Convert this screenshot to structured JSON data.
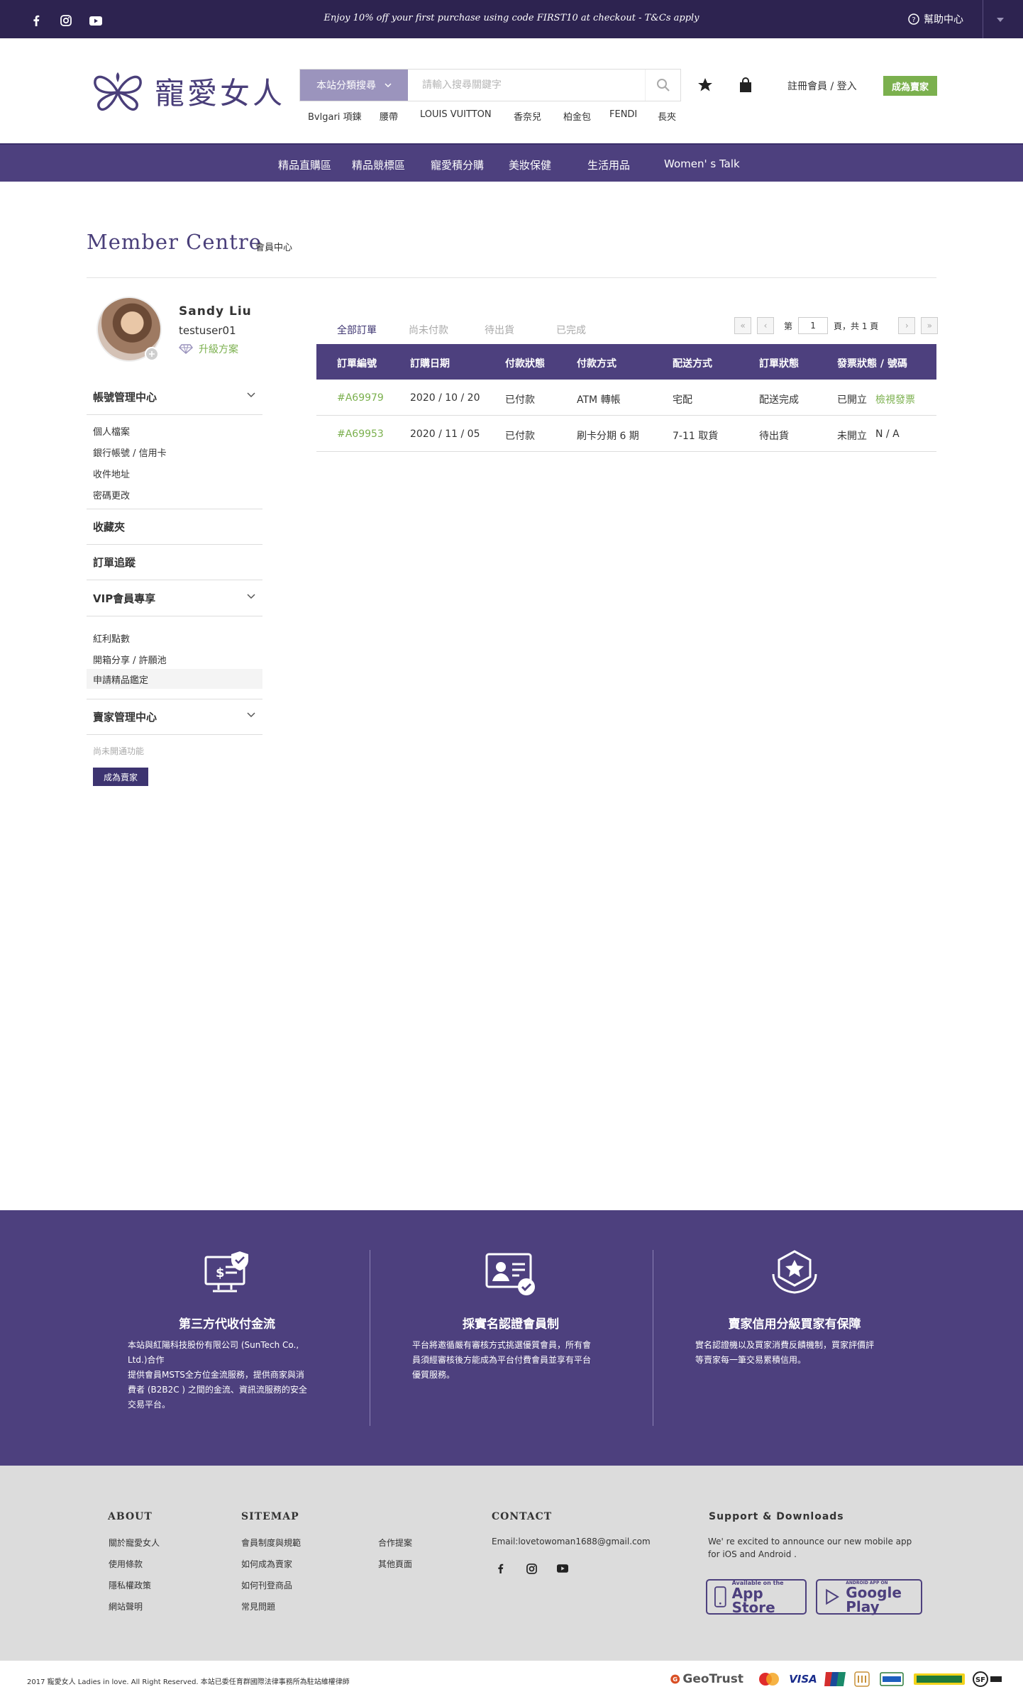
{
  "topbar": {
    "promo": "Enjoy 10% off your first purchase using code FIRST10 at checkout - T&Cs apply",
    "help": "幫助中心",
    "social_icons": [
      "facebook-icon",
      "instagram-icon",
      "youtube-icon"
    ]
  },
  "header": {
    "logo_text": "寵愛女人",
    "search_category": "本站分類搜尋",
    "search_placeholder": "請輸入搜尋關鍵字",
    "hot_keywords": [
      "Bvlgari 項鍊",
      "腰帶",
      "LOUIS VUITTON",
      "香奈兒",
      "柏金包",
      "FENDI",
      "長夾"
    ],
    "register_login": "註冊會員 / 登入",
    "become_seller": "成為賣家"
  },
  "nav": {
    "items": [
      "精品直購區",
      "精品競標區",
      "寵愛積分購",
      "美妝保健",
      "生活用品",
      "Women' s Talk"
    ]
  },
  "page": {
    "title_en": "Member Centre",
    "title_zh": "會員中心"
  },
  "user": {
    "name": "Sandy Liu",
    "id": "testuser01",
    "upgrade": "升級方案"
  },
  "sidebar": {
    "account_center": "帳號管理中心",
    "account_items": [
      "個人檔案",
      "銀行帳號 / 信用卡",
      "收件地址",
      "密碼更改"
    ],
    "favorites": "收藏夾",
    "order_tracking": "訂單追蹤",
    "vip": "VIP會員專享",
    "vip_items": [
      "紅利點數",
      "開箱分享 / 許願池",
      "申請精品鑑定"
    ],
    "seller_center": "賣家管理中心",
    "seller_note": "尚未開通功能",
    "become_seller": "成為賣家"
  },
  "orders": {
    "tabs": [
      "全部訂單",
      "尚未付款",
      "待出貨",
      "已完成"
    ],
    "pager": {
      "first": "«",
      "prev": "‹",
      "next": "›",
      "last": "»",
      "prefix": "第",
      "current": "1",
      "suffix": "頁，共 1 頁"
    },
    "columns": [
      "訂單編號",
      "訂購日期",
      "付款狀態",
      "付款方式",
      "配送方式",
      "訂單狀態",
      "發票狀態 / 號碼"
    ],
    "rows": [
      {
        "id": "#A69979",
        "date": "2020 / 10 / 20",
        "pay_status": "已付款",
        "pay_method": "ATM 轉帳",
        "ship_method": "宅配",
        "order_status": "配送完成",
        "invoice_status": "已開立",
        "invoice_value": "檢視發票"
      },
      {
        "id": "#A69953",
        "date": "2020 / 11 / 05",
        "pay_status": "已付款",
        "pay_method": "刷卡分期 6 期",
        "ship_method": "7-11 取貨",
        "order_status": "待出貨",
        "invoice_status": "未開立",
        "invoice_value": "N / A"
      }
    ]
  },
  "trust": {
    "items": [
      {
        "title": "第三方代收付金流",
        "text": [
          "本站與紅陽科技股份有限公司 (SunTech Co.,",
          "Ltd.)合作",
          "提供會員MSTS全方位金流服務，提供商家與消",
          "費者 (B2B2C ) 之間的金流、資訊流服務的安全",
          "交易平台。"
        ]
      },
      {
        "title": "採實名認證會員制",
        "text": [
          "平台將邀循嚴有審核方式挑選優質會員，所有會",
          "員須經審核後方能成為平台付費會員並享有平台",
          "優質服務。"
        ]
      },
      {
        "title": "賣家信用分級買家有保障",
        "text": [
          "實名認證機以及買家消費反饋機制，買家評價評",
          "等賣家每一筆交易累積信用。"
        ]
      }
    ]
  },
  "footer": {
    "about_title": "ABOUT",
    "about_links": [
      "關於寵愛女人",
      "使用條款",
      "隱私權政策",
      "網站聲明"
    ],
    "sitemap_title": "SITEMAP",
    "sitemap_col1": [
      "會員制度與規範",
      "如何成為賣家",
      "如何刊登商品",
      "常見問題"
    ],
    "sitemap_col2": [
      "合作提案",
      "其他頁面"
    ],
    "contact_title": "CONTACT",
    "contact_email": "Email:lovetowoman1688@gmail.com",
    "support_title": "Support & Downloads",
    "support_text": [
      "We' re excited to announce our new mobile app",
      " for iOS and Android ."
    ],
    "appstore_small": "Available on the",
    "appstore_big": "App Store",
    "googleplay_small": "ANDROID APP ON",
    "googleplay_big": "Google Play"
  },
  "bottom": {
    "copyright": "2017 寵愛女人 Ladies in love. All Right Reserved.    本站已委任育群國際法律事務所為駐站維權律師",
    "payment_logos": [
      "GeoTrust",
      "MasterCard",
      "VISA",
      "UnionPay",
      "JCB",
      "FamilyMart",
      "宅急便",
      "SF Express"
    ],
    "geotrust": "GeoTrust",
    "visa": "VISA"
  },
  "colors": {
    "topbar": "#2d2350",
    "primary": "#4d407e",
    "accent_green": "#7bb04e",
    "footer_bg": "#dcdcdc"
  }
}
